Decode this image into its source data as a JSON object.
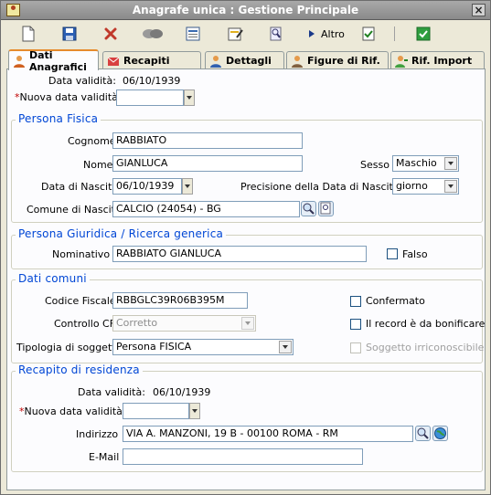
{
  "window": {
    "title": "Anagrafe unica : Gestione Principale"
  },
  "toolbar": {
    "buttons": [
      {
        "name": "new-icon"
      },
      {
        "name": "save-icon"
      },
      {
        "name": "delete-icon"
      },
      {
        "name": "link-icon"
      },
      {
        "name": "form-icon"
      },
      {
        "name": "edit-doc-icon"
      },
      {
        "name": "search-settings-icon"
      },
      {
        "name": "arrow-right-icon",
        "label": "Altro"
      },
      {
        "name": "check-doc-icon"
      },
      {
        "name": "confirm-icon"
      }
    ],
    "altro_label": "Altro"
  },
  "tabs": [
    {
      "label": "Dati Anagrafici",
      "active": true
    },
    {
      "label": "Recapiti"
    },
    {
      "label": "Dettagli"
    },
    {
      "label": "Figure di Rif."
    },
    {
      "label": "Rif. Import"
    }
  ],
  "top": {
    "data_validita_label": "Data validità:",
    "data_validita_value": "06/10/1939",
    "nuova_data_label": "Nuova data validità",
    "nuova_data_value": ""
  },
  "persona_fisica": {
    "title": "Persona Fisica",
    "cognome_label": "Cognome",
    "cognome_value": "RABBIATO",
    "nome_label": "Nome",
    "nome_value": "GIANLUCA",
    "sesso_label": "Sesso",
    "sesso_value": "Maschio",
    "data_nascita_label": "Data di Nascita",
    "data_nascita_value": "06/10/1939",
    "precisione_label": "Precisione della Data di Nascita al",
    "precisione_value": "giorno",
    "comune_label": "Comune di Nascita",
    "comune_value": "CALCIO (24054) - BG"
  },
  "persona_giuridica": {
    "title": "Persona Giuridica / Ricerca generica",
    "nominativo_label": "Nominativo",
    "nominativo_value": "RABBIATO GIANLUCA",
    "falso_label": "Falso"
  },
  "dati_comuni": {
    "title": "Dati comuni",
    "cf_label": "Codice Fiscale",
    "cf_value": "RBBGLC39R06B395M",
    "controllo_label": "Controllo CF",
    "controllo_value": "Corretto",
    "tipologia_label": "Tipologia di soggetto",
    "tipologia_value": "Persona FISICA",
    "confermato_label": "Confermato",
    "bonificare_label": "Il record è da bonificare",
    "irriconoscibile_label": "Soggetto irriconoscibile"
  },
  "recapito": {
    "title": "Recapito di residenza",
    "data_validita_label": "Data validità:",
    "data_validita_value": "06/10/1939",
    "nuova_data_label": "Nuova data validità",
    "nuova_data_value": "",
    "indirizzo_label": "Indirizzo",
    "indirizzo_value": "VIA A. MANZONI, 19 B - 00100 ROMA - RM",
    "email_label": "E-Mail",
    "email_value": ""
  },
  "colors": {
    "accent": "#0046d5",
    "required": "#c00000",
    "tab_highlight": "#e68b2c"
  }
}
